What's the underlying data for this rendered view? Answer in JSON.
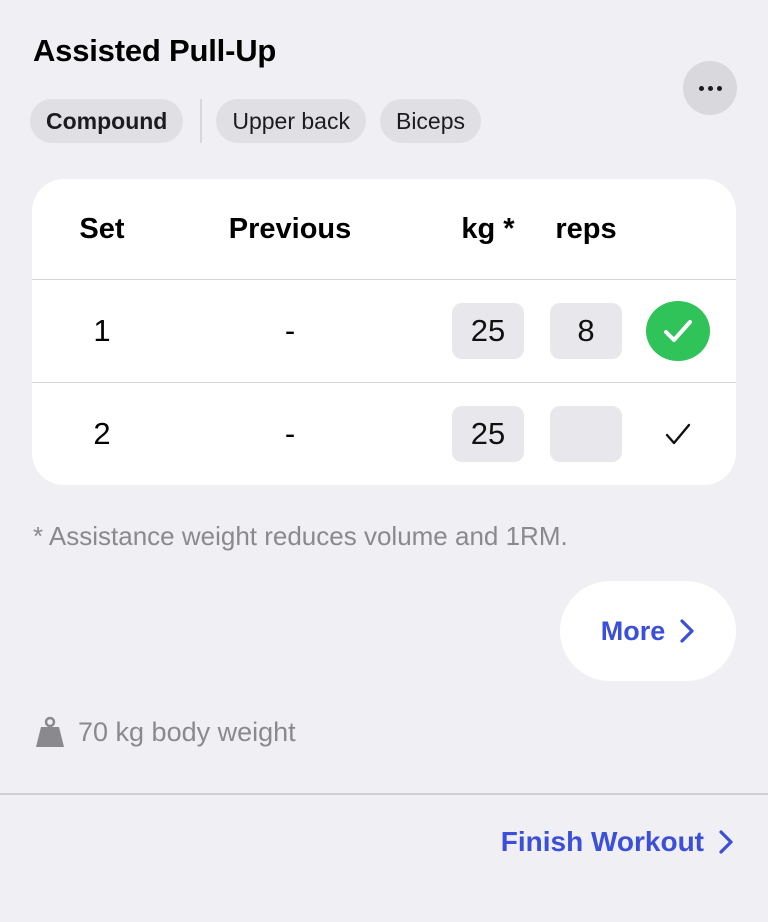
{
  "exercise": {
    "title": "Assisted Pull-Up",
    "tags": [
      {
        "label": "Compound",
        "primary": true
      },
      {
        "label": "Upper back",
        "primary": false
      },
      {
        "label": "Biceps",
        "primary": false
      }
    ]
  },
  "table": {
    "headers": {
      "set": "Set",
      "previous": "Previous",
      "kg": "kg *",
      "reps": "reps"
    },
    "rows": [
      {
        "set": "1",
        "previous": "-",
        "kg": "25",
        "reps": "8",
        "completed": true
      },
      {
        "set": "2",
        "previous": "-",
        "kg": "25",
        "reps": "",
        "completed": false
      }
    ]
  },
  "footnote": "* Assistance weight reduces volume and 1RM.",
  "more_button": {
    "label": "More"
  },
  "body_weight": {
    "text": "70 kg body weight",
    "icon": "weight-icon"
  },
  "finish": {
    "label": "Finish Workout"
  },
  "colors": {
    "accent": "#3b4fd8",
    "success": "#2fc35a",
    "background": "#efeff4",
    "secondary_text": "#8a8a8e"
  }
}
